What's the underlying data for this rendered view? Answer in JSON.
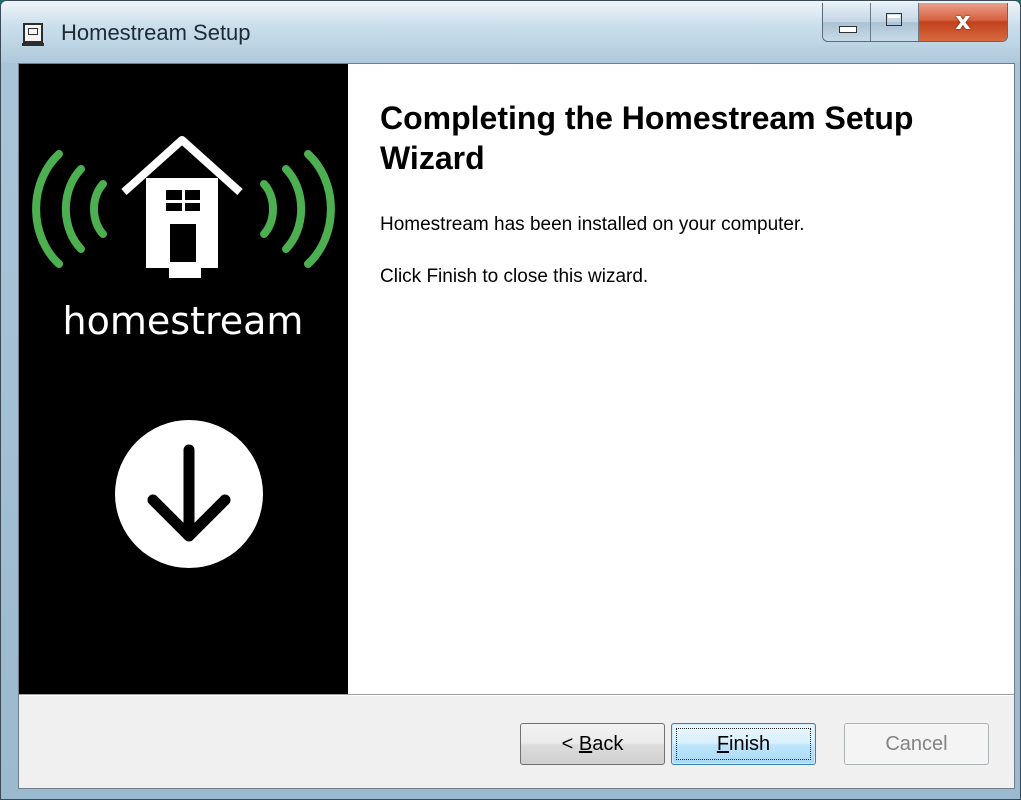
{
  "window": {
    "title": "Homestream Setup",
    "controls": {
      "minimize": "minimize",
      "maximize": "maximize",
      "close": "x"
    }
  },
  "banner": {
    "brand": "homestream"
  },
  "content": {
    "heading": "Completing the Homestream Setup Wizard",
    "line1": "Homestream has been installed on your computer.",
    "line2": "Click Finish to close this wizard."
  },
  "buttons": {
    "back": {
      "prefix": "< ",
      "mnemonic": "B",
      "rest": "ack"
    },
    "finish": {
      "mnemonic": "F",
      "rest": "inish"
    },
    "cancel": "Cancel"
  },
  "colors": {
    "accent_green": "#4caf50",
    "banner_bg": "#000000",
    "disabled_text": "#838383"
  }
}
